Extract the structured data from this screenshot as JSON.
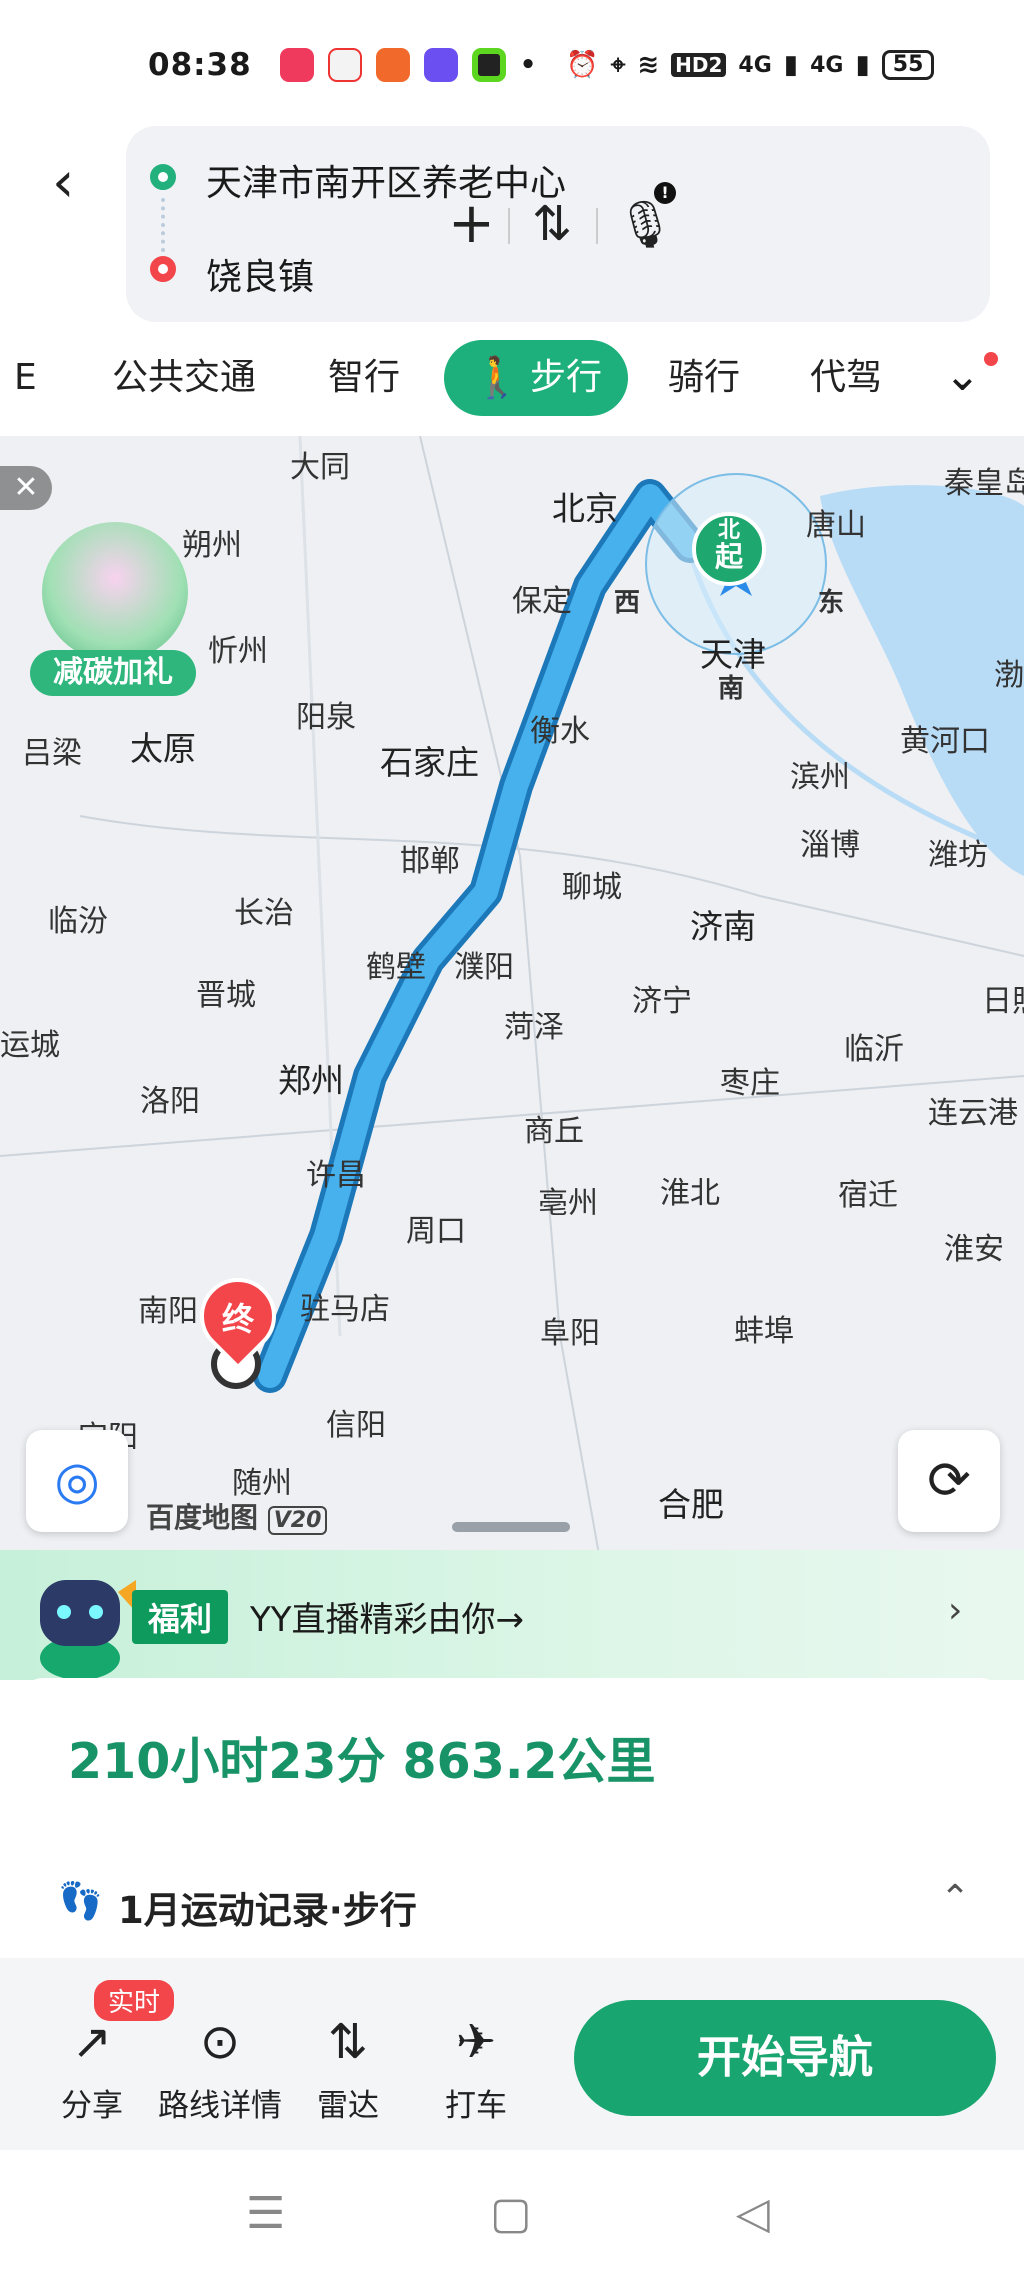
{
  "status_bar": {
    "time": "08:38",
    "network1": "4G",
    "network2": "4G",
    "hd": "HD2",
    "battery": "55",
    "icons": [
      "music-app-icon",
      "maps-app-icon",
      "video-app-icon",
      "notes-app-icon",
      "app-icon",
      "dot-icon",
      "alarm-icon",
      "location-icon",
      "wifi-icon"
    ]
  },
  "route": {
    "start": "天津市南开区养老中心",
    "end": "饶良镇"
  },
  "tabs": [
    {
      "label": "E"
    },
    {
      "label": "公共交通"
    },
    {
      "label": "智行"
    },
    {
      "label": "步行"
    },
    {
      "label": "骑行"
    },
    {
      "label": "代驾"
    }
  ],
  "map": {
    "promo_label": "减碳加礼",
    "start_marker": "起",
    "north_marker": "北",
    "end_marker": "终",
    "compass": {
      "w": "西",
      "e": "东",
      "s": "南"
    },
    "logo": "百度地图",
    "logo_version": "V20",
    "cities": [
      {
        "name": "大同"
      },
      {
        "name": "秦皇岛"
      },
      {
        "name": "北京"
      },
      {
        "name": "唐山"
      },
      {
        "name": "朔州"
      },
      {
        "name": "保定"
      },
      {
        "name": "忻州"
      },
      {
        "name": "天津"
      },
      {
        "name": "渤"
      },
      {
        "name": "阳泉"
      },
      {
        "name": "衡水"
      },
      {
        "name": "黄河口"
      },
      {
        "name": "吕梁"
      },
      {
        "name": "太原"
      },
      {
        "name": "石家庄"
      },
      {
        "name": "滨州"
      },
      {
        "name": "淄博"
      },
      {
        "name": "邯郸"
      },
      {
        "name": "潍坊"
      },
      {
        "name": "聊城"
      },
      {
        "name": "临汾"
      },
      {
        "name": "长治"
      },
      {
        "name": "济南"
      },
      {
        "name": "鹤壁"
      },
      {
        "name": "濮阳"
      },
      {
        "name": "晋城"
      },
      {
        "name": "济宁"
      },
      {
        "name": "日照"
      },
      {
        "name": "运城"
      },
      {
        "name": "菏泽"
      },
      {
        "name": "临沂"
      },
      {
        "name": "郑州"
      },
      {
        "name": "枣庄"
      },
      {
        "name": "洛阳"
      },
      {
        "name": "连云港"
      },
      {
        "name": "商丘"
      },
      {
        "name": "许昌"
      },
      {
        "name": "亳州"
      },
      {
        "name": "淮北"
      },
      {
        "name": "宿迁"
      },
      {
        "name": "周口"
      },
      {
        "name": "淮安"
      },
      {
        "name": "南阳"
      },
      {
        "name": "驻马店"
      },
      {
        "name": "阜阳"
      },
      {
        "name": "蚌埠"
      },
      {
        "name": "信阳"
      },
      {
        "name": "宜阳"
      },
      {
        "name": "随州"
      },
      {
        "name": "合肥"
      }
    ]
  },
  "banner": {
    "tag": "福利",
    "text": "YY直播精彩由你→"
  },
  "summary": {
    "duration_distance": "210小时23分 863.2公里"
  },
  "record": {
    "label": "1月运动记录·步行"
  },
  "actions": {
    "badge": "实时",
    "share": "分享",
    "detail": "路线详情",
    "radar": "雷达",
    "taxi": "打车",
    "navigate": "开始导航"
  },
  "colors": {
    "accent": "#1db07c",
    "route_line": "#2f9ce0",
    "end_marker": "#f2464b"
  }
}
